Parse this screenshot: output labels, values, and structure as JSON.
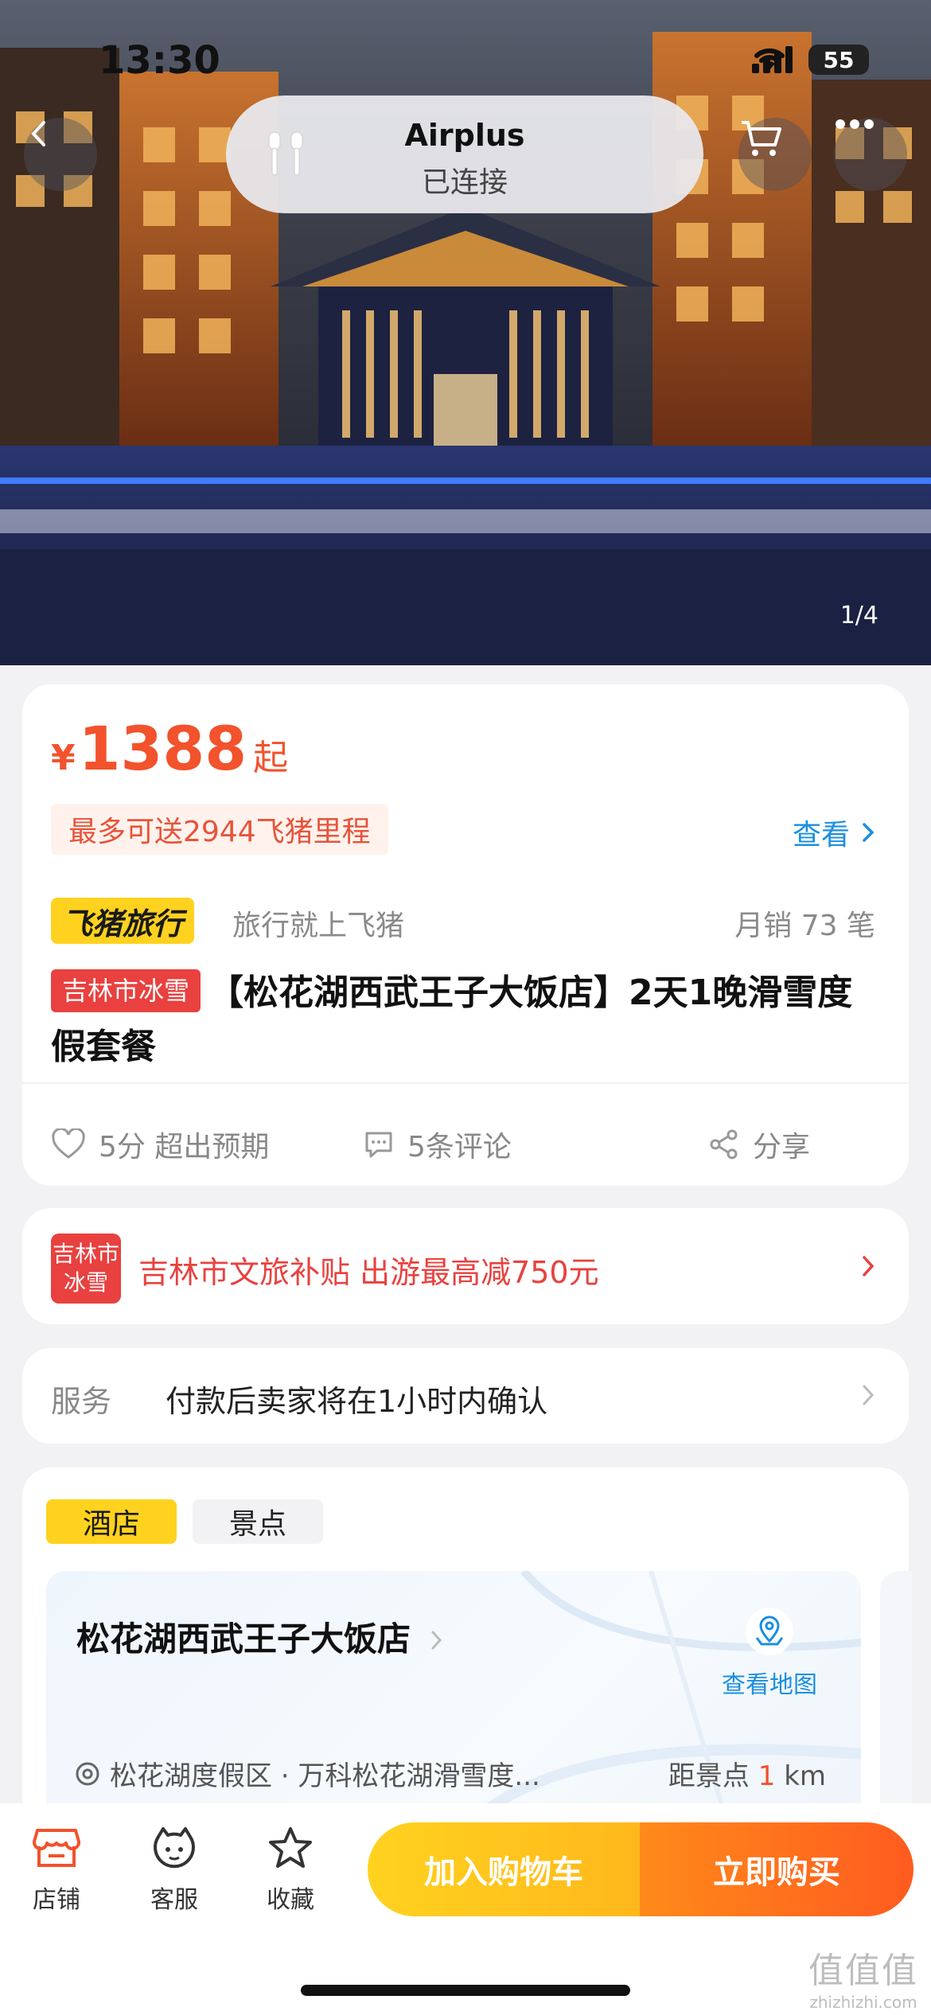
{
  "status_bar": {
    "time": "13:30",
    "battery": "55"
  },
  "airplus": {
    "title": "Airplus",
    "subtitle": "已连接"
  },
  "gallery": {
    "counter": "1/4"
  },
  "price": {
    "currency": "¥",
    "amount": "1388",
    "suffix": "起"
  },
  "mileage": {
    "text": "最多可送2944飞猪里程",
    "link": "查看"
  },
  "brand": {
    "badge": "飞猪旅行",
    "slogan": "旅行就上飞猪",
    "monthly_sales": "月销 73 笔"
  },
  "product": {
    "tag": "吉林市冰雪",
    "title": "【松花湖西武王子大饭店】2天1晚滑雪度假套餐"
  },
  "actions": {
    "rating": "5分 超出预期",
    "reviews": "5条评论",
    "share": "分享"
  },
  "subsidy": {
    "icon_line1": "吉林市",
    "icon_line2": "冰雪",
    "text": "吉林市文旅补贴 出游最高减750元"
  },
  "service": {
    "label": "服务",
    "text": "付款后卖家将在1小时内确认"
  },
  "tabs": [
    "酒店",
    "景点"
  ],
  "hotel": {
    "name": "松花湖西武王子大饭店",
    "map_label": "查看地图",
    "location": "松花湖度假区 · 万科松花湖滑雪度...",
    "distance_prefix": "距景点",
    "distance_value": "1",
    "distance_unit": "km"
  },
  "bottom_nav": {
    "store": "店铺",
    "service": "客服",
    "favorite": "收藏",
    "add_cart": "加入购物车",
    "buy_now": "立即购买"
  },
  "watermark": {
    "big": "值值值",
    "small": "zhizhizhi.com"
  },
  "colors": {
    "accent": "#f2522c",
    "brand_yellow": "#ffd21f",
    "link_blue": "#1b8fe0",
    "tag_red": "#e8413f"
  }
}
